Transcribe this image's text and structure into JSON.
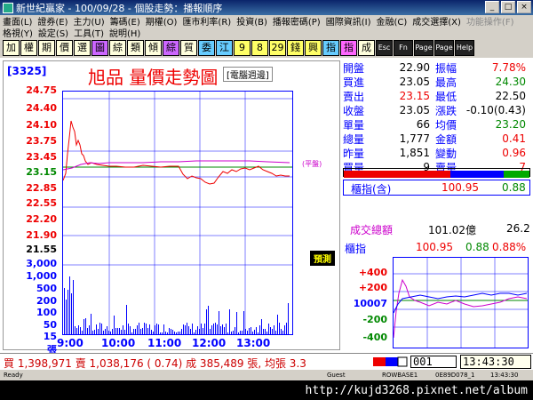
{
  "window": {
    "title": "新世紀贏家 - 100/09/28 - 個股走勢：播報順序",
    "min": "_",
    "max": "□",
    "close": "×"
  },
  "menu": {
    "row1": [
      "畫面(L)",
      "證券(E)",
      "主力(U)",
      "籌碼(E)",
      "期權(O)",
      "匯市利率(R)",
      "投資(B)",
      "播報密碼(P)",
      "國際資訊(I)",
      "金融(C)",
      "成交選擇(X)",
      "功能操作(F)"
    ],
    "row2": [
      "格視(Y)",
      "設定(S)",
      "工具(T)",
      "說明(H)"
    ]
  },
  "toolbar": [
    "加",
    "權",
    "期",
    "價",
    "選",
    "圖",
    "綜",
    "類",
    "傾",
    "綜",
    "質",
    "委",
    "江",
    "9",
    "8",
    "29",
    "錢",
    "興",
    "指",
    "指",
    "成",
    "Esc",
    "Fn",
    "Page Up",
    "Page Dn",
    "Help"
  ],
  "header": {
    "code": "[3325]",
    "title": "旭品 量價走勢圖",
    "sub": "[電腦週邊]"
  },
  "price_axis": [
    "24.75",
    "24.40",
    "24.10",
    "23.75",
    "23.45",
    "23.15",
    "22.85",
    "22.55",
    "22.20",
    "21.90",
    "21.55"
  ],
  "volume_axis": [
    "3,000",
    "1,000",
    "500",
    "200",
    "100",
    "50",
    "15",
    "張"
  ],
  "time_axis": [
    "9:00",
    "10:00",
    "11:00",
    "12:00",
    "13:00"
  ],
  "badge": "預測",
  "ref_tag": "(平盤)",
  "quote": [
    {
      "k1": "開盤",
      "v1": "22.90",
      "k2": "振幅",
      "v2": "7.78%",
      "c2": "#e00"
    },
    {
      "k1": "買進",
      "v1": "23.05",
      "k2": "最高",
      "v2": "24.30",
      "c2": "#080"
    },
    {
      "k1": "賣出",
      "v1": "23.15",
      "k2": "最低",
      "v2": "22.50",
      "c2": "#000",
      "c1": "#e00"
    },
    {
      "k1": "收盤",
      "v1": "23.05",
      "k2": "漲跌",
      "v2": "-0.10(0.43)",
      "c2": "#000"
    },
    {
      "k1": "單量",
      "v1": "66",
      "k2": "均價",
      "v2": "23.20",
      "c2": "#080"
    },
    {
      "k1": "總量",
      "v1": "1,777",
      "k2": "金額",
      "v2": "0.41",
      "c2": "#e00"
    },
    {
      "k1": "昨量",
      "v1": "1,851",
      "k2": "變動",
      "v2": "0.96",
      "c2": "#e00"
    },
    {
      "k1": "買量",
      "v1": "9",
      "k2": "賣量",
      "v2": "7",
      "c2": "#e00"
    }
  ],
  "index_box": {
    "label": "櫃指(含)",
    "value": "100.95",
    "change": "0.88"
  },
  "turnover": {
    "label": "成交總額",
    "value": "101.02億",
    "change": "26.2"
  },
  "mini": {
    "label": "櫃指",
    "value": "100.95",
    "change": "0.88",
    "pct": "0.88%",
    "axis": [
      "+400",
      "+200",
      "10007",
      "-200",
      "-400"
    ]
  },
  "status": {
    "text": "買 1,398,971 賣 1,038,176 ( 0.74) 成 385,489 張, 均張 3.3",
    "page": "001",
    "clock": "13:43:30"
  },
  "winstatus": [
    "Ready",
    "Guest",
    "ROWBASE1",
    "0E89D078_1",
    "13:43:30"
  ],
  "url": "http://kujd3268.pixnet.net/album",
  "colors": {
    "accent_red": "#e00",
    "accent_blue": "#00f",
    "accent_green": "#080"
  }
}
